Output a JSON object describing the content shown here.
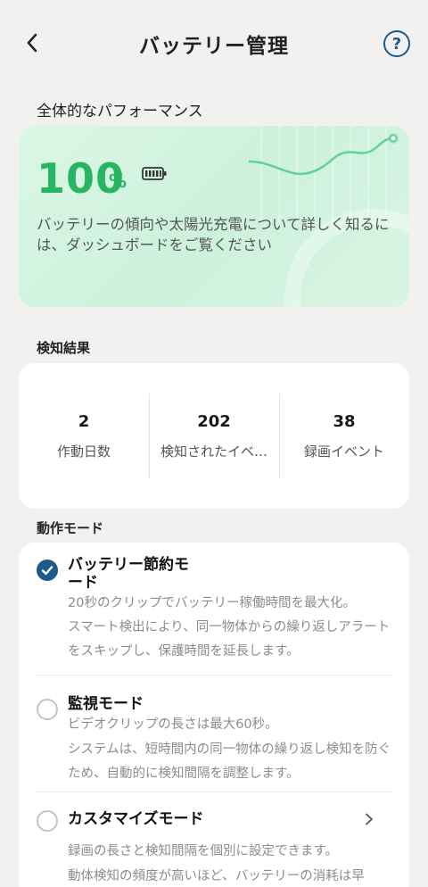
{
  "header": {
    "title": "バッテリー管理",
    "back_icon": "chevron-left-icon",
    "help_icon": "help-circle-icon",
    "help_glyph": "?"
  },
  "performance": {
    "section_title": "全体的なパフォーマンス",
    "value": "100",
    "unit": "%",
    "battery_icon": "battery-full-icon",
    "description": "バッテリーの傾向や太陽光充電について詳しく知るには、ダッシュボードをご覧ください",
    "accent_color": "#27b463"
  },
  "detection": {
    "section_title": "検知結果",
    "stats": [
      {
        "value": "2",
        "label": "作動日数"
      },
      {
        "value": "202",
        "label": "検知されたイベ…"
      },
      {
        "value": "38",
        "label": "録画イベント"
      }
    ]
  },
  "modes": {
    "section_title": "動作モード",
    "items": [
      {
        "name": "バッテリー節約モード",
        "selected": true,
        "desc1": "20秒のクリップでバッテリー稼働時間を最大化。",
        "desc2": "スマート検出により、同一物体からの繰り返しアラートをスキップし、保護時間を延長します。"
      },
      {
        "name": "監視モード",
        "selected": false,
        "desc1": "ビデオクリップの長さは最大60秒。",
        "desc2": "システムは、短時間内の同一物体の繰り返し検知を防ぐため、自動的に検知間隔を調整します。"
      },
      {
        "name": "カスタマイズモード",
        "selected": false,
        "has_chevron": true,
        "desc1": "録画の長さと検知間隔を個別に設定できます。",
        "desc2": "動体検知の頻度が高いほど、バッテリーの消耗は早"
      }
    ],
    "selected_color": "#1d5a8a"
  }
}
